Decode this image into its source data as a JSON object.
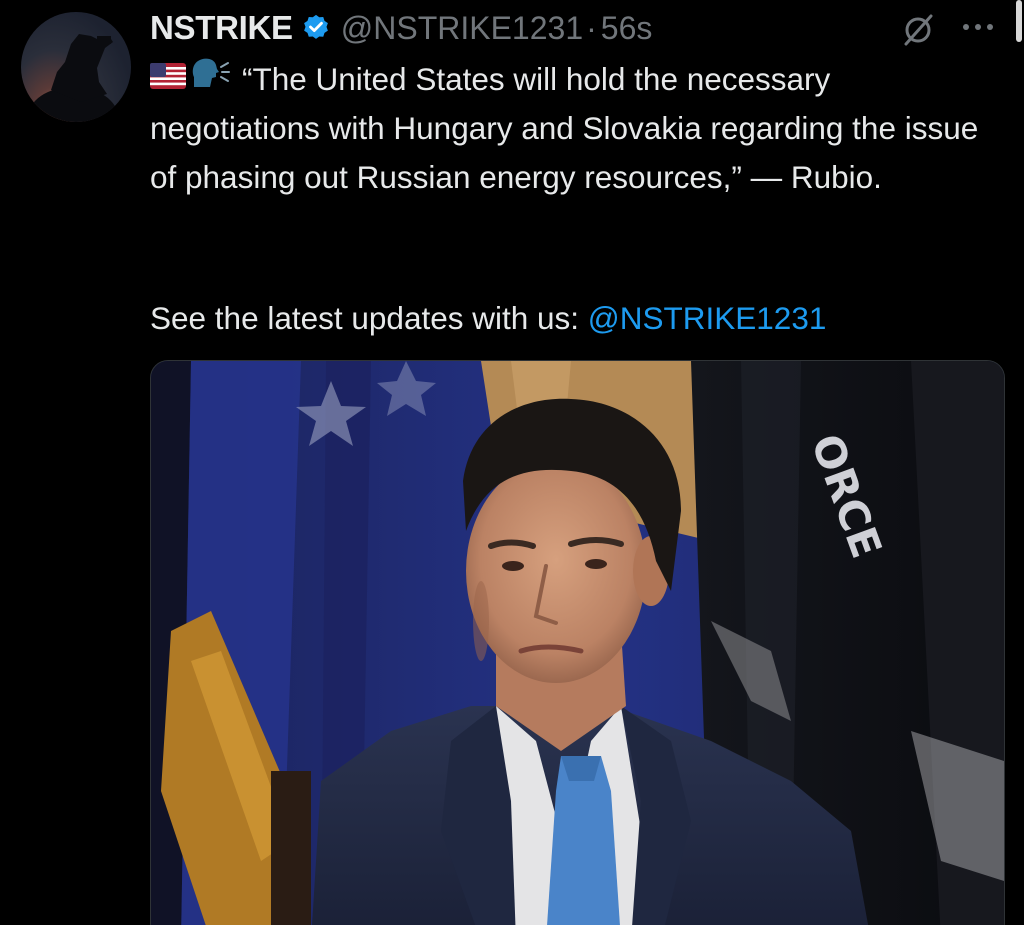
{
  "tweet": {
    "author": {
      "display_name": "NSTRIKE",
      "handle": "@NSTRIKE1231",
      "verified": true
    },
    "separator": "·",
    "timestamp": "56s",
    "body": {
      "flag_emoji": "us-flag-emoji",
      "speaker_emoji": "speaking-head-emoji",
      "quote": "“The United States will hold the necessary negotiations with Hungary and Slovakia regarding the issue of phasing out Russian energy resources,” — Rubio.",
      "cta_prefix": "See the latest updates with us: ",
      "cta_mention": "@NSTRIKE1231"
    },
    "media": {
      "type": "photo",
      "background_text": "ORCE"
    },
    "icons": {
      "grok": "grok-icon",
      "more": "more-icon"
    }
  },
  "colors": {
    "background": "#000000",
    "text": "#e7e9ea",
    "secondary": "#71767b",
    "accent": "#1d9bf0"
  }
}
